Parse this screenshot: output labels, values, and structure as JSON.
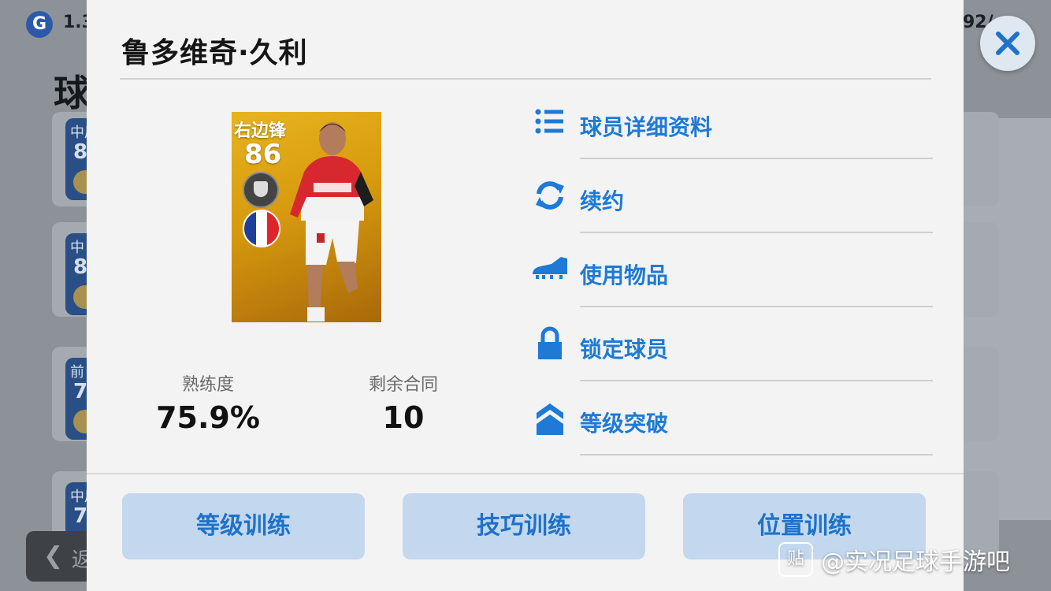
{
  "background": {
    "version_fragment": "1.3",
    "count_fragment": "92/",
    "title_fragment": "球",
    "cards": [
      {
        "position": "中后",
        "value": "8"
      },
      {
        "position": "中",
        "value": "8"
      },
      {
        "position": "前",
        "value": "7"
      },
      {
        "position": "中后",
        "value": "7"
      }
    ],
    "back_label": "返"
  },
  "dialog": {
    "title": "鲁多维奇·久利",
    "card": {
      "position": "右边锋",
      "rating": "86",
      "flag_colors": [
        "#1f3f99",
        "#ffffff",
        "#e0242b"
      ]
    },
    "stats": [
      {
        "label": "熟练度",
        "value": "75.9%"
      },
      {
        "label": "剩余合同",
        "value": "10"
      }
    ],
    "menu": [
      {
        "label": "球员详细资料",
        "icon": "list-icon"
      },
      {
        "label": "续约",
        "icon": "refresh-icon"
      },
      {
        "label": "使用物品",
        "icon": "boot-icon"
      },
      {
        "label": "锁定球员",
        "icon": "lock-icon"
      },
      {
        "label": "等级突破",
        "icon": "level-up-icon"
      }
    ],
    "buttons": [
      "等级训练",
      "技巧训练",
      "位置训练"
    ]
  },
  "close_icon": "close-icon",
  "accent_color": "#1e7ad6",
  "watermark": {
    "icon_text": "贴",
    "text": "@实况足球手游吧"
  }
}
